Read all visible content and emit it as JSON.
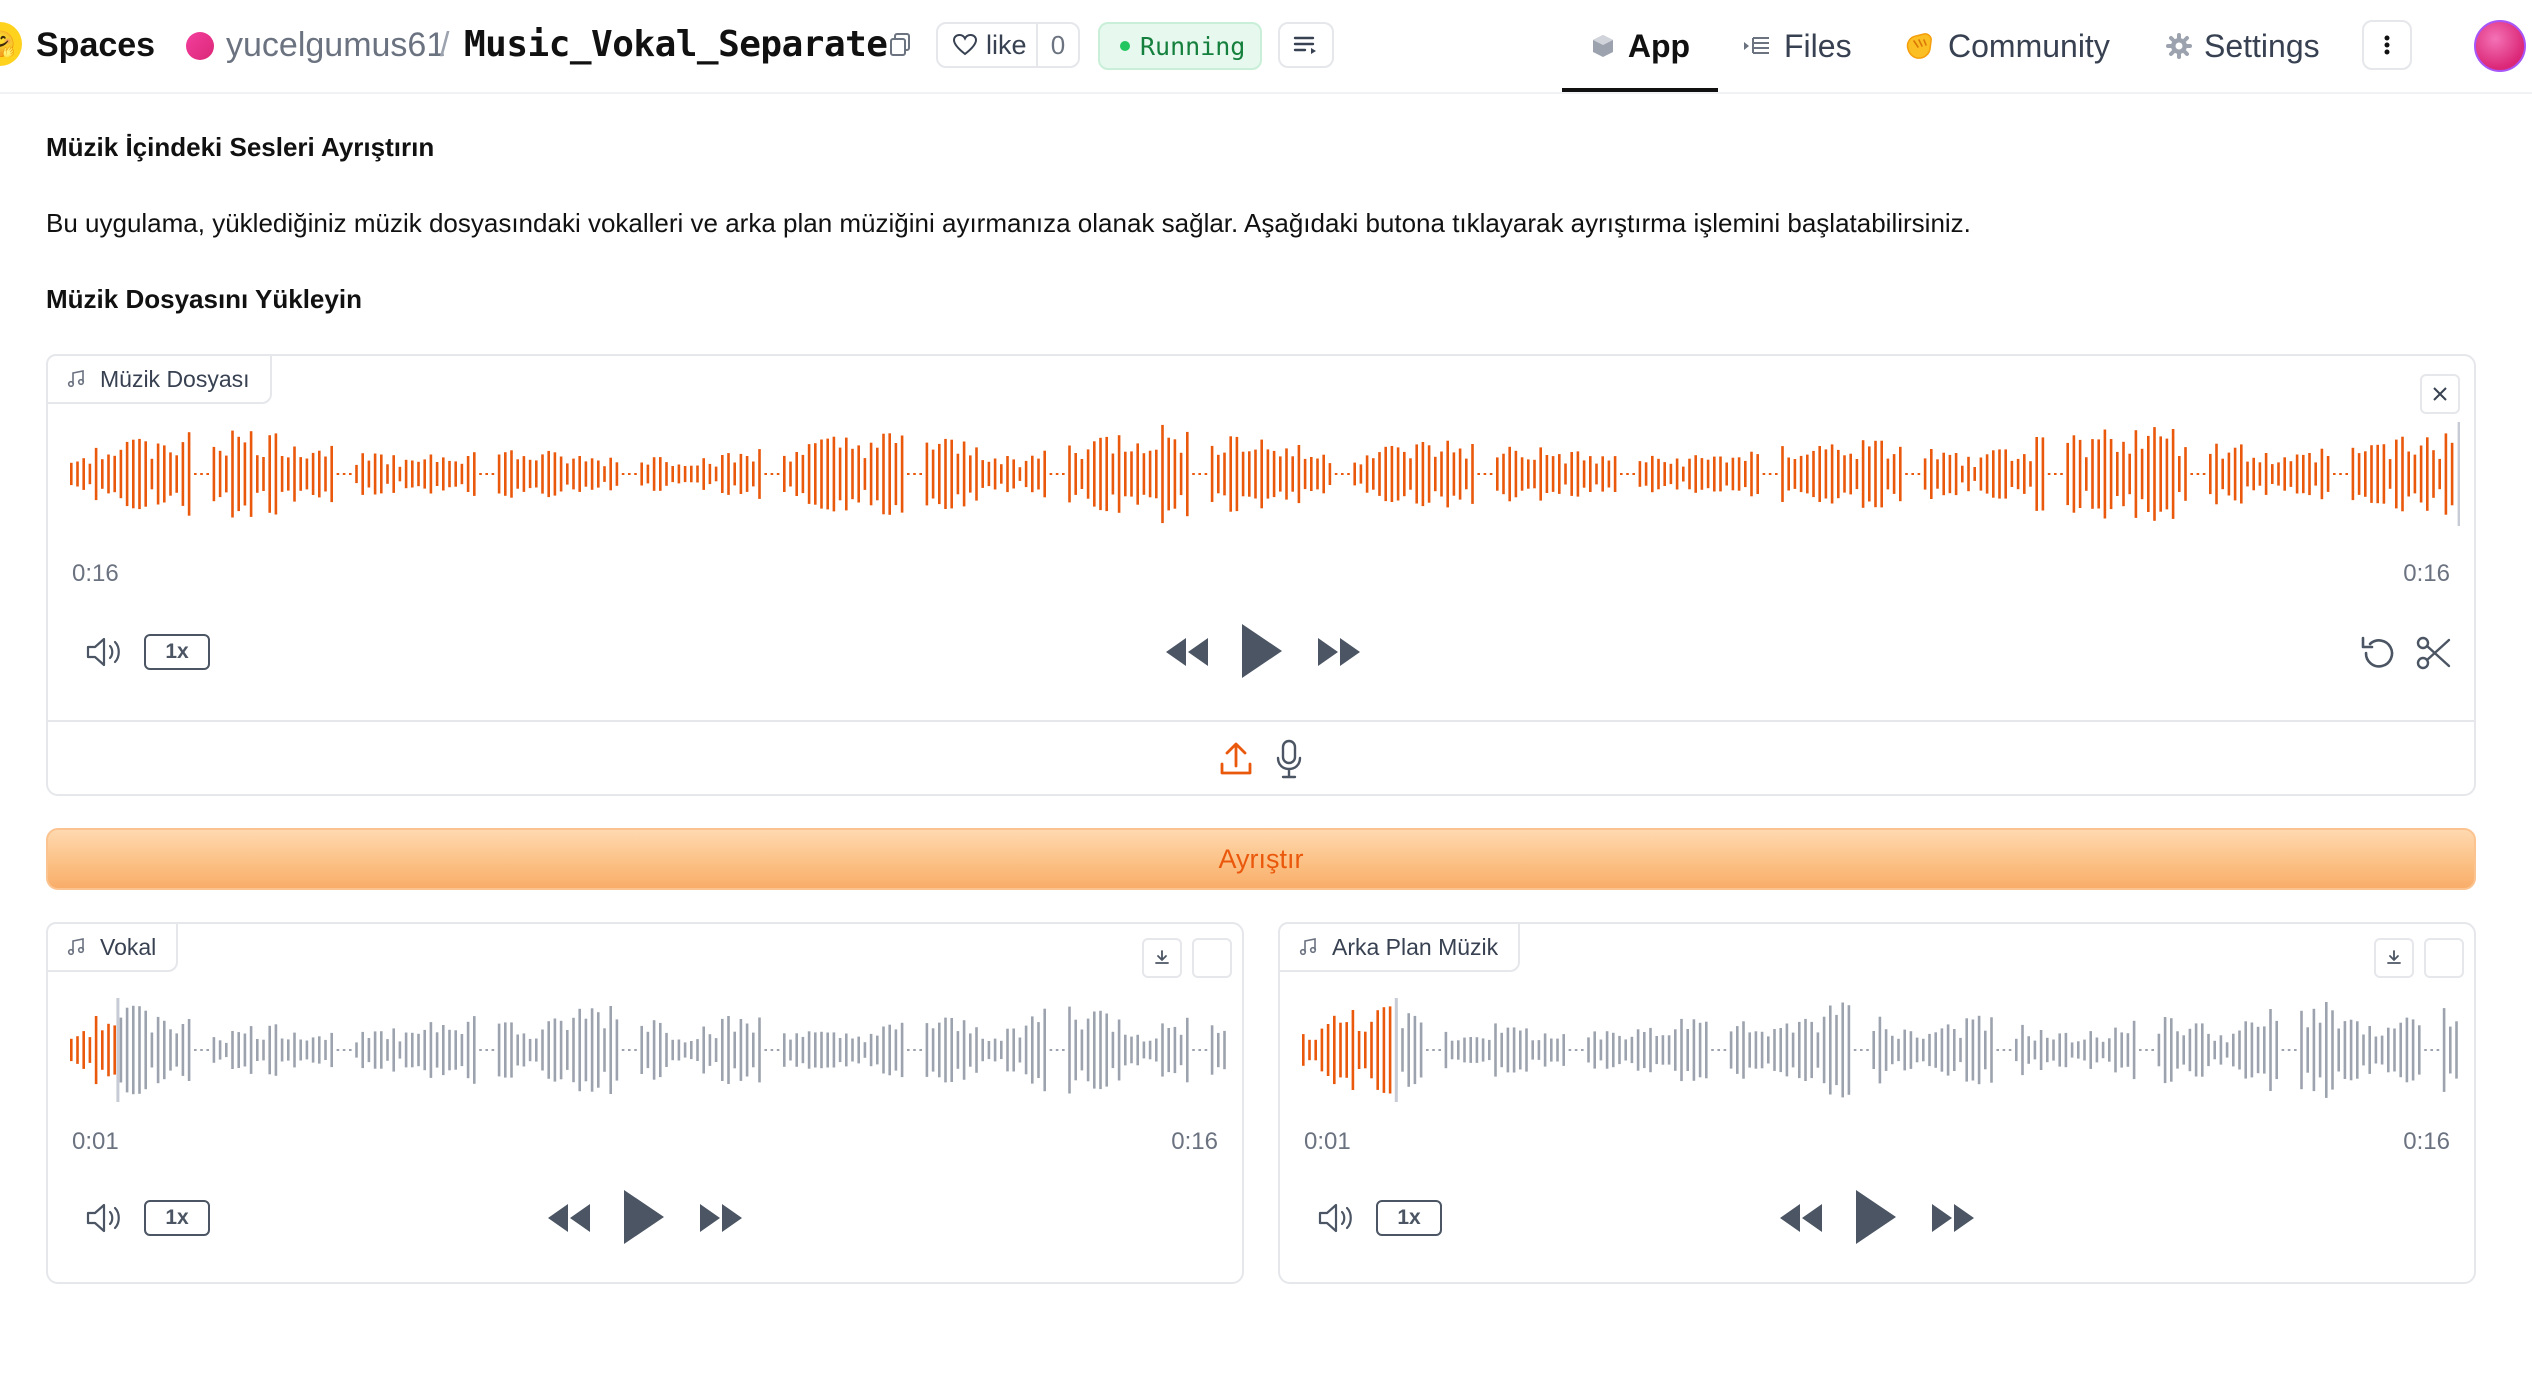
{
  "header": {
    "brand": "Spaces",
    "owner": "yucelgumus61",
    "separator": "/",
    "repo": "Music_Vokal_Separate",
    "like_label": "like",
    "like_count": "0",
    "status": "Running",
    "tabs": [
      {
        "label": "App",
        "active": true
      },
      {
        "label": "Files",
        "active": false
      },
      {
        "label": "Community",
        "active": false
      },
      {
        "label": "Settings",
        "active": false
      }
    ]
  },
  "main": {
    "title": "Müzik İçindeki Sesleri Ayrıştırın",
    "description": "Bu uygulama, yüklediğiniz müzik dosyasındaki vokalleri ve arka plan müziğini ayırmanıza olanak sağlar. Aşağıdaki butona tıklayarak ayrıştırma işlemini başlatabilirsiniz.",
    "upload_heading": "Müzik Dosyasını Yükleyin",
    "input_audio": {
      "label": "Müzik Dosyası",
      "time_current": "0:16",
      "time_total": "0:16",
      "speed": "1x",
      "progress": 1.0
    },
    "separate_button": "Ayrıştır",
    "outputs": [
      {
        "label": "Vokal",
        "time_current": "0:01",
        "time_total": "0:16",
        "speed": "1x",
        "progress": 0.04
      },
      {
        "label": "Arka Plan Müzik",
        "time_current": "0:01",
        "time_total": "0:16",
        "speed": "1x",
        "progress": 0.08
      }
    ]
  },
  "colors": {
    "waveform_played": "#ea580c",
    "waveform_unplayed": "#9ca3af",
    "button_text": "#ea580c",
    "status_green": "#22c55e"
  },
  "icons": [
    "music-note-icon",
    "close-icon",
    "volume-icon",
    "rewind-icon",
    "play-icon",
    "fast-forward-icon",
    "undo-icon",
    "scissors-icon",
    "upload-icon",
    "microphone-icon",
    "download-icon",
    "heart-icon",
    "copy-icon",
    "more-icon"
  ]
}
